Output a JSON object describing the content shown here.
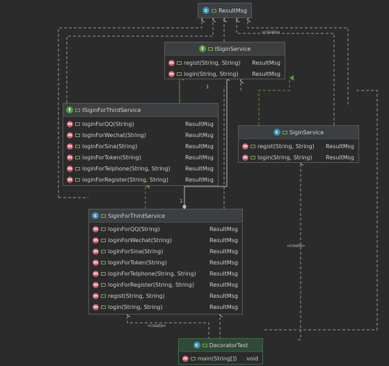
{
  "nodes": {
    "resultmsg": {
      "icon": "class-icon",
      "title": "ResultMsg"
    },
    "isiginservice": {
      "icon": "interface-icon",
      "title": "ISiginService",
      "methods": [
        {
          "sig": "regist(String, String)",
          "ret": "ResultMsg"
        },
        {
          "sig": "login(String, String)",
          "ret": "ResultMsg"
        }
      ]
    },
    "isiginforthirdservice": {
      "icon": "interface-icon",
      "title": "ISiginForThirdService",
      "methods": [
        {
          "sig": "loginForQQ(String)",
          "ret": "ResultMsg"
        },
        {
          "sig": "loginForWechat(String)",
          "ret": "ResultMsg"
        },
        {
          "sig": "loginForSina(String)",
          "ret": "ResultMsg"
        },
        {
          "sig": "loginForToken(String)",
          "ret": "ResultMsg"
        },
        {
          "sig": "loginForTelphone(String, String)",
          "ret": "ResultMsg"
        },
        {
          "sig": "loginForRegister(String, String)",
          "ret": "ResultMsg"
        }
      ]
    },
    "siginservice": {
      "icon": "class-icon",
      "title": "SiginService",
      "methods": [
        {
          "sig": "regist(String, String)",
          "ret": "ResultMsg"
        },
        {
          "sig": "login(String, String)",
          "ret": "ResultMsg"
        }
      ]
    },
    "siginforthirdservice": {
      "icon": "class-icon",
      "title": "SiginForThirdService",
      "methods": [
        {
          "sig": "loginForQQ(String)",
          "ret": "ResultMsg"
        },
        {
          "sig": "loginForWechat(String)",
          "ret": "ResultMsg"
        },
        {
          "sig": "loginForSina(String)",
          "ret": "ResultMsg"
        },
        {
          "sig": "loginForToken(String)",
          "ret": "ResultMsg"
        },
        {
          "sig": "loginForTelphone(String, String)",
          "ret": "ResultMsg"
        },
        {
          "sig": "loginForRegister(String, String)",
          "ret": "ResultMsg"
        },
        {
          "sig": "regist(String, String)",
          "ret": "ResultMsg"
        },
        {
          "sig": "login(String, String)",
          "ret": "ResultMsg"
        }
      ]
    },
    "decoratortest": {
      "icon": "class-icon",
      "title": "DecoratorTest",
      "methods": [
        {
          "sig": "main(String[])",
          "ret": "void"
        }
      ]
    }
  },
  "edge_labels": {
    "create_top": "«create»",
    "create_right": "«create»",
    "create_bottom": "«create»",
    "multiplicity_isigin": "1",
    "multiplicity_third": "1"
  },
  "colors": {
    "background": "#2b2b2b",
    "header": "#3c3f41",
    "class_icon": "#3a8fb7",
    "interface_icon": "#5a9a3c",
    "method_icon": "#c65a6a",
    "realization": "#5a9a3c",
    "dependency": "#bbbbbb"
  }
}
